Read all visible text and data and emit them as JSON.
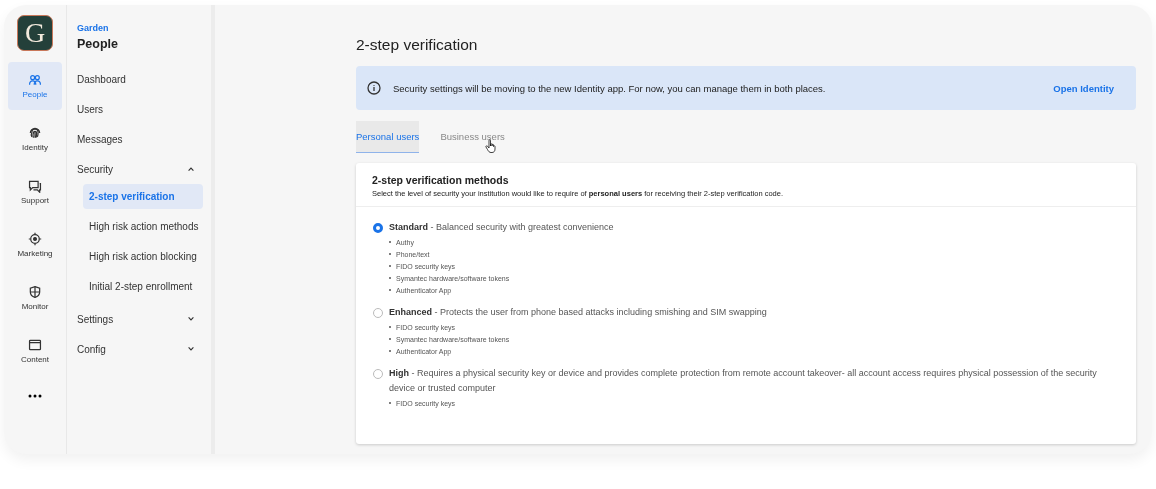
{
  "logo": {
    "letter": "G"
  },
  "rail": [
    {
      "label": "People",
      "kind": "people",
      "selected": true
    },
    {
      "label": "Identity",
      "kind": "fingerprint",
      "selected": false
    },
    {
      "label": "Support",
      "kind": "chat",
      "selected": false
    },
    {
      "label": "Marketing",
      "kind": "target",
      "selected": false
    },
    {
      "label": "Monitor",
      "kind": "shield",
      "selected": false
    },
    {
      "label": "Content",
      "kind": "window",
      "selected": false
    }
  ],
  "nav": {
    "context": "Garden",
    "title": "People",
    "items": [
      {
        "label": "Dashboard",
        "selected": false
      },
      {
        "label": "Users",
        "selected": false
      },
      {
        "label": "Messages",
        "selected": false
      },
      {
        "label": "Security",
        "expanded": true,
        "children": [
          {
            "label": "2-step verification",
            "selected": true
          },
          {
            "label": "High risk action methods",
            "selected": false
          },
          {
            "label": "High risk action blocking",
            "selected": false
          },
          {
            "label": "Initial 2-step enrollment",
            "selected": false
          }
        ]
      },
      {
        "label": "Settings",
        "expanded": false
      },
      {
        "label": "Config",
        "expanded": false
      }
    ]
  },
  "page_title": "2-step verification",
  "banner": {
    "text": "Security settings will be moving to the new Identity app. For now, you can manage them in both places.",
    "link": "Open Identity"
  },
  "tabs": [
    {
      "label": "Personal users",
      "selected": true
    },
    {
      "label": "Business users",
      "selected": false
    }
  ],
  "card": {
    "title": "2-step verification methods",
    "subtitle": "Select the level of security your institution would like to require of **personal users** for receiving their 2-step verification code.",
    "options": [
      {
        "label": "**Standard** - Balanced security with greatest convenience",
        "selected": true,
        "methods": [
          "Authy",
          "Phone/text",
          "FIDO security keys",
          "Symantec hardware/software tokens",
          "Authenticator App"
        ]
      },
      {
        "label": "**Enhanced** - Protects the user from phone based attacks including smishing and SIM swapping",
        "selected": false,
        "methods": [
          "FIDO security keys",
          "Symantec hardware/software tokens",
          "Authenticator App"
        ]
      },
      {
        "label": "**High** - Requires a physical security key or device and provides complete protection from remote account takeover- all account access requires physical possession of the security device or trusted computer",
        "selected": false,
        "methods": [
          "FIDO security keys"
        ]
      }
    ]
  }
}
